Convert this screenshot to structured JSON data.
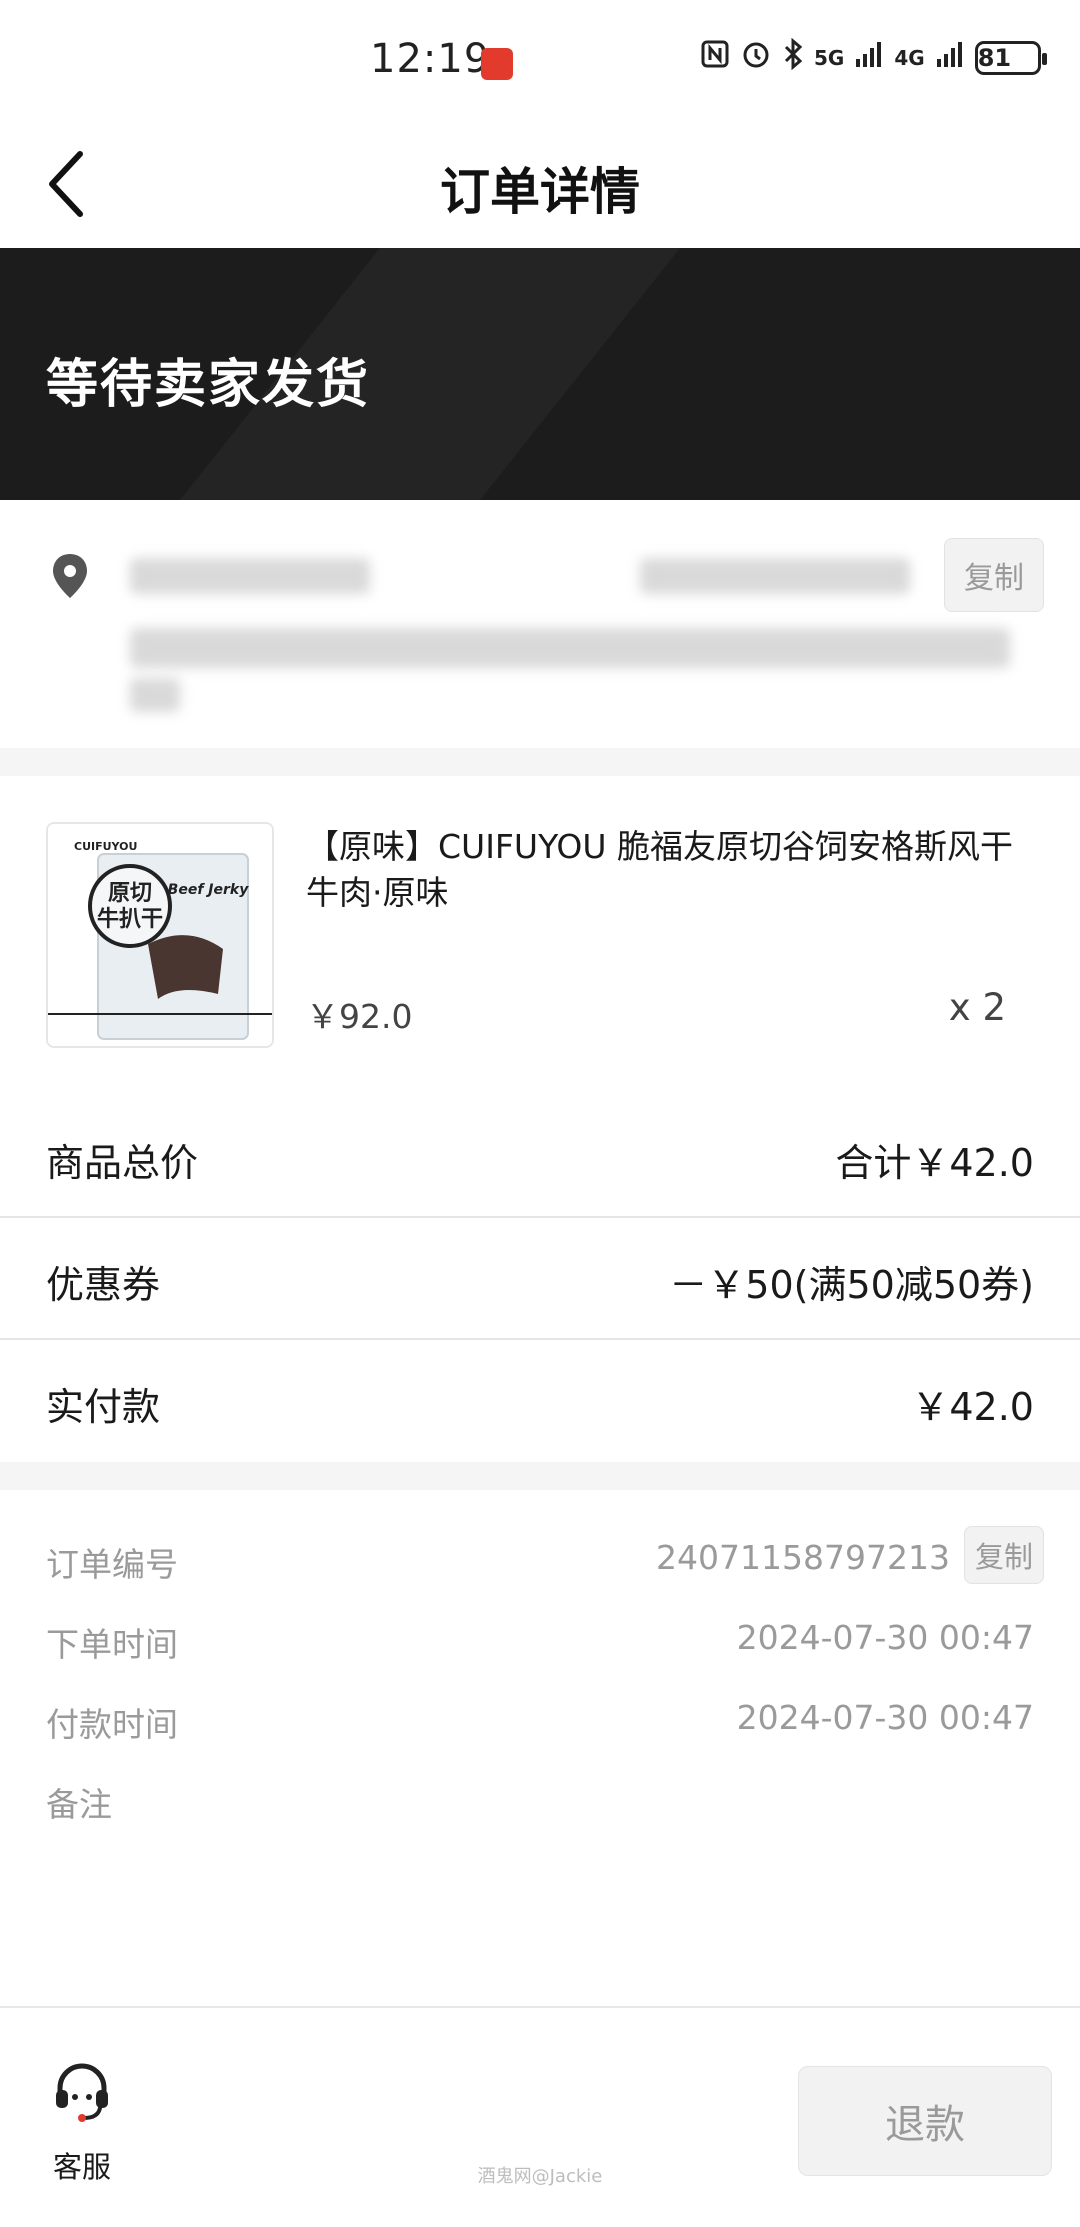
{
  "status_bar": {
    "time": "12:19",
    "network_1": "5G",
    "network_2": "4G",
    "battery": "81"
  },
  "header": {
    "title": "订单详情"
  },
  "banner": {
    "status_text": "等待卖家发货"
  },
  "address": {
    "copy_label": "复制"
  },
  "product": {
    "name": "【原味】CUIFUYOU 脆福友原切谷饲安格斯风干牛肉·原味",
    "price": "￥92.0",
    "quantity": "x 2",
    "thumb_brand": "CUIFUYOU",
    "thumb_text": "原切牛扒干",
    "thumb_en": "Beef Jerky"
  },
  "summary": {
    "goods_total_label": "商品总价",
    "goods_total_value": "合计￥42.0",
    "coupon_label": "优惠券",
    "coupon_value": "－￥50(满50减50券)",
    "paid_label": "实付款",
    "paid_value": "￥42.0"
  },
  "order_info": {
    "order_no_label": "订单编号",
    "order_no_value": "24071158797213",
    "copy_label": "复制",
    "order_time_label": "下单时间",
    "order_time_value": "2024-07-30 00:47",
    "pay_time_label": "付款时间",
    "pay_time_value": "2024-07-30 00:47",
    "remark_label": "备注"
  },
  "bottom_bar": {
    "service_label": "客服",
    "refund_label": "退款",
    "watermark": "酒鬼网@Jackie"
  },
  "colors": {
    "banner_bg": "#1c1c1c",
    "muted_text": "#9a9a9a",
    "divider": "#e5e5e5"
  }
}
